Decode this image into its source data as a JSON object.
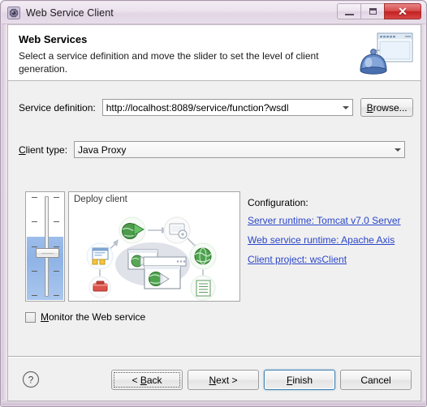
{
  "window": {
    "title": "Web Service Client",
    "app_icon": "gear-icon",
    "minimize_label": "Minimize",
    "maximize_label": "Maximize",
    "close_label": "Close",
    "close_glyph": "✕"
  },
  "header": {
    "title": "Web Services",
    "description": "Select a service definition and move the slider to set the level of client generation.",
    "icon": "web-services-banner-icon"
  },
  "form": {
    "service_definition": {
      "label": "Service definition:",
      "value": "http://localhost:8089/service/function?wsdl",
      "placeholder": "",
      "browse_label": "Browse...",
      "browse_mnemonic": "B",
      "browse_rest": "rowse..."
    },
    "client_type": {
      "label_mnemonic": "C",
      "label_rest": "lient type:",
      "value": "Java Proxy"
    }
  },
  "scenario": {
    "slider": {
      "name": "client-generation-slider",
      "fill_percent": 58,
      "handle_percent": 56,
      "tick_count": 5
    },
    "diagram": {
      "caption": "Deploy client",
      "name": "deploy-client-diagram"
    }
  },
  "configuration": {
    "title": "Configuration:",
    "links": [
      {
        "label": "Server runtime: Tomcat v7.0 Server",
        "name": "server-runtime-link"
      },
      {
        "label": "Web service runtime: Apache Axis",
        "name": "web-service-runtime-link"
      },
      {
        "label": "Client project: wsClient",
        "name": "client-project-link"
      }
    ],
    "link_color": "#2b46c8"
  },
  "monitor": {
    "checked": false,
    "label_pre": "",
    "label_mnemonic": "M",
    "label_rest": "onitor the Web service"
  },
  "buttons": {
    "help": "?",
    "back": "< Back",
    "back_mnemonic": "B",
    "next": "Next >",
    "next_mnemonic": "N",
    "finish": "Finish",
    "finish_mnemonic": "F",
    "cancel": "Cancel"
  },
  "colors": {
    "title_bar": "#e8dee9",
    "dialog_bg": "#f0f0f0",
    "banner_bg": "#ffffff",
    "link": "#2b46c8",
    "slider_fill": "#9dbdea",
    "default_button_border": "#3c7fb1",
    "close_button": "#d64a4a"
  }
}
